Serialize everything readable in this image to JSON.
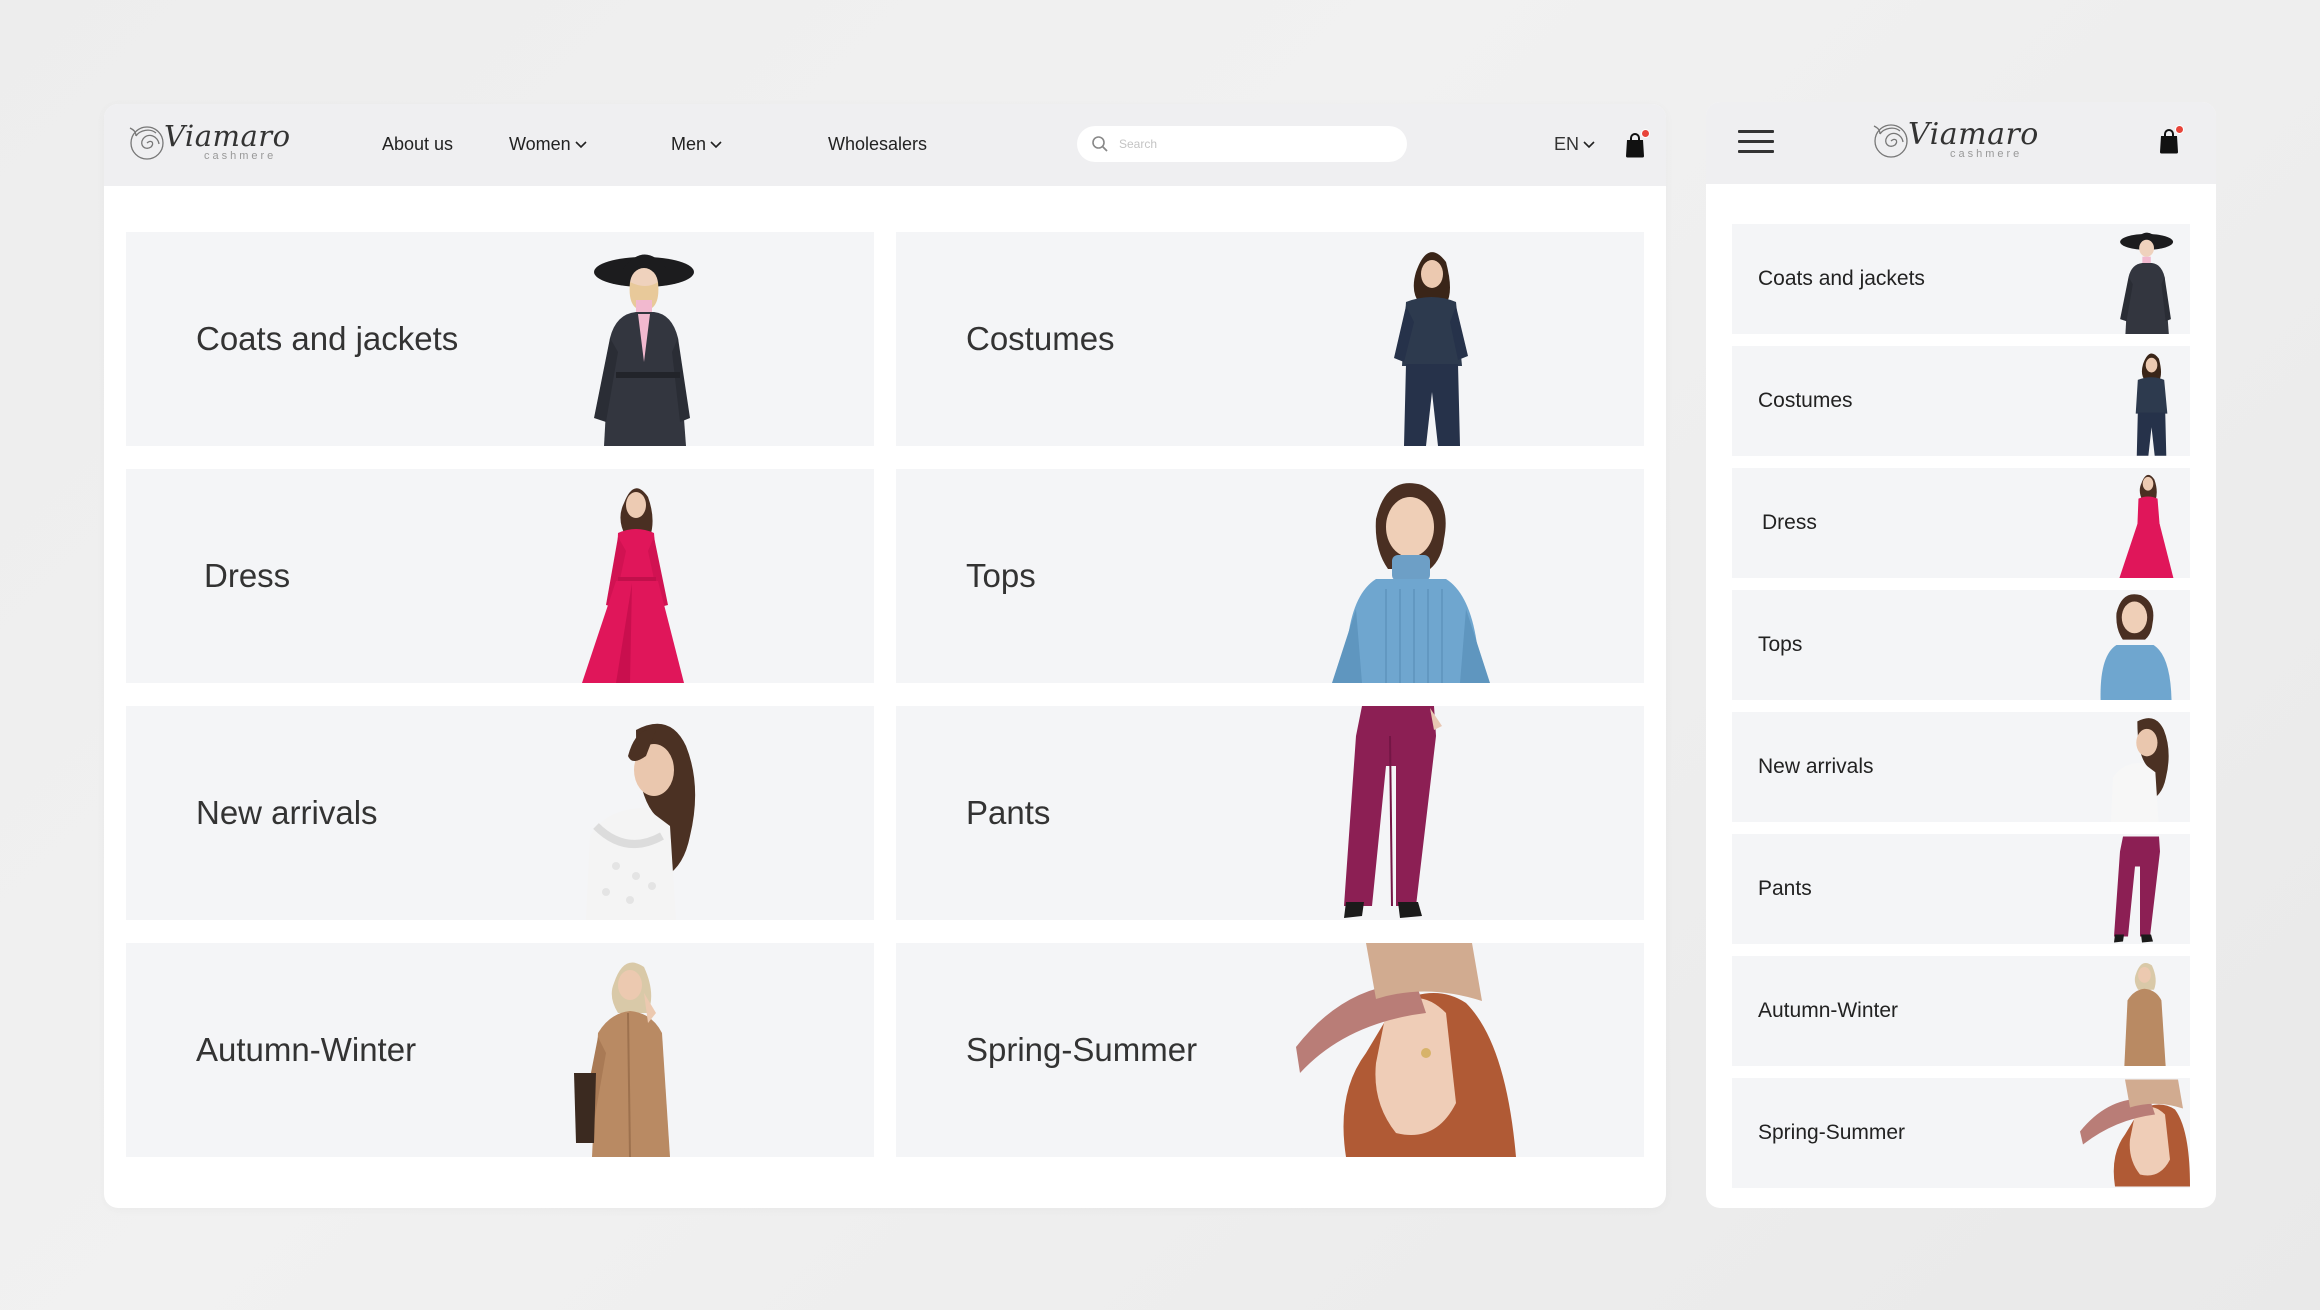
{
  "brand": {
    "name": "Viamaro",
    "subtitle": "cashmere"
  },
  "nav": {
    "items": [
      {
        "label": "About us",
        "has_dropdown": false
      },
      {
        "label": "Women",
        "has_dropdown": true
      },
      {
        "label": "Men",
        "has_dropdown": true
      },
      {
        "label": "Wholesalers",
        "has_dropdown": false
      }
    ],
    "search_placeholder": "Search",
    "language": "EN"
  },
  "categories": [
    {
      "label": "Coats and jackets",
      "figure": "coat",
      "color": "#2e323c"
    },
    {
      "label": "Costumes",
      "figure": "costume",
      "color": "#2d3a4e"
    },
    {
      "label": "Dress",
      "figure": "dress",
      "color": "#e0165a"
    },
    {
      "label": "Tops",
      "figure": "sweater",
      "color": "#6fa6cf"
    },
    {
      "label": "New arrivals",
      "figure": "blouse",
      "color": "#f2f2f2"
    },
    {
      "label": "Pants",
      "figure": "pants",
      "color": "#8c1f54"
    },
    {
      "label": "Autumn-Winter",
      "figure": "camel-coat",
      "color": "#b98a63"
    },
    {
      "label": "Spring-Summer",
      "figure": "visor",
      "color": "#b97d77"
    }
  ],
  "colors": {
    "accent_badge": "#e8443a",
    "card_bg": "#f4f5f7",
    "header_bg": "#efeff1"
  },
  "icons": [
    "search-icon",
    "chevron-down-icon",
    "shopping-bag-icon",
    "menu-icon",
    "rose-logo-icon"
  ]
}
